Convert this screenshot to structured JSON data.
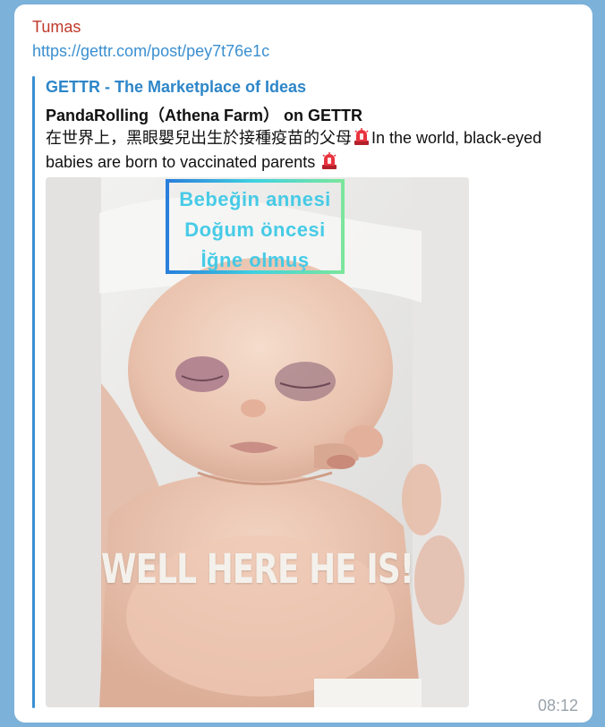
{
  "message": {
    "sender": "Tumas",
    "link": "https://gettr.com/post/pey7t76e1c",
    "time": "08:12"
  },
  "preview": {
    "site_name": "GETTR - The Marketplace of Ideas",
    "title": "PandaRolling（Athena Farm） on GETTR",
    "desc_part1": "在世界上，黑眼嬰兒出生於接種疫苗的父母",
    "desc_part2": "In the world, black-eyed babies are born to vaccinated parents",
    "media": {
      "overlay_lines": [
        "Bebeğin annesi",
        "Doğum öncesi",
        "İğne olmuş"
      ],
      "caption": "WELL HERE HE IS!"
    }
  },
  "colors": {
    "background": "#7cb1d9",
    "sender": "#c0392b",
    "link": "#3a8fd0",
    "site": "#2d86c8",
    "time": "#9aa3ab"
  },
  "icons": [
    "siren-emoji-icon"
  ]
}
